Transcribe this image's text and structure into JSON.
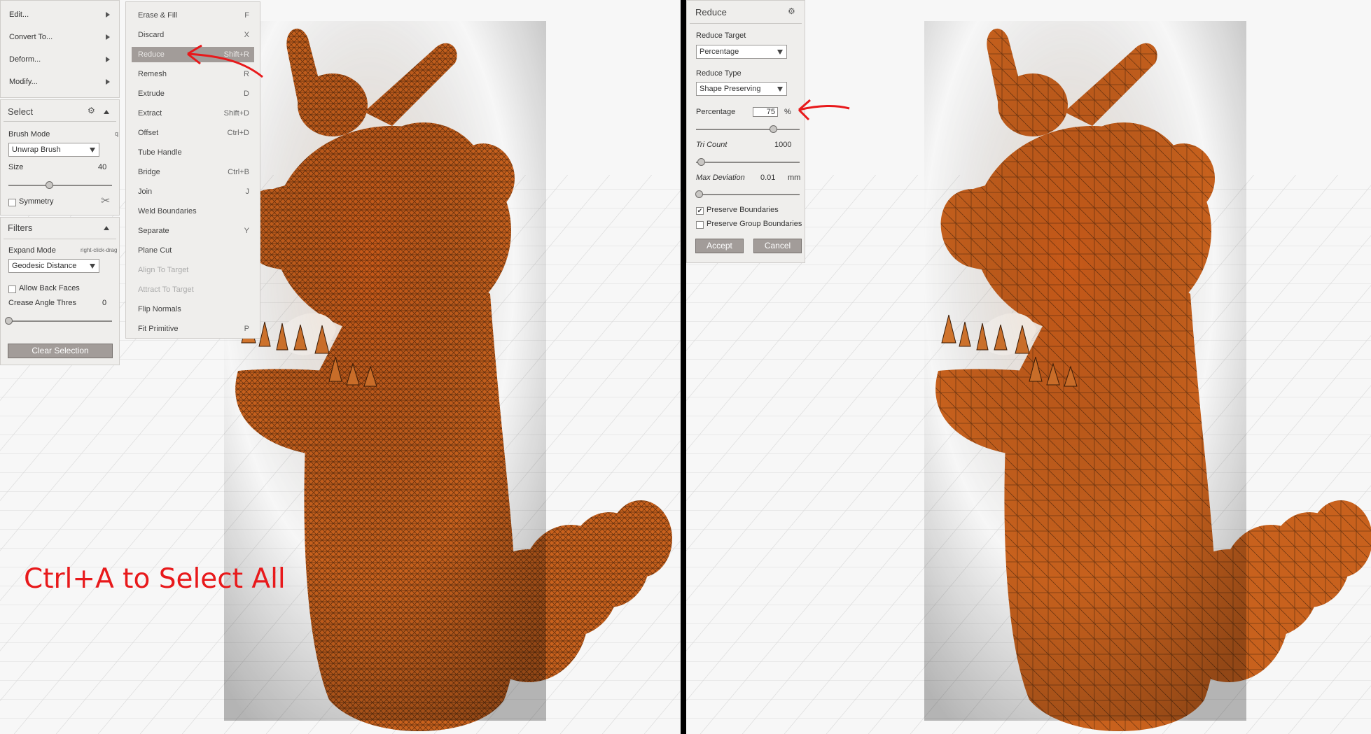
{
  "left": {
    "edit_menu": [
      {
        "label": "Edit..."
      },
      {
        "label": "Convert To..."
      },
      {
        "label": "Deform..."
      },
      {
        "label": "Modify..."
      }
    ],
    "select_panel": {
      "title": "Select",
      "brush_mode_label": "Brush Mode",
      "brush_mode_hotkey": "q",
      "brush_mode_value": "Unwrap Brush",
      "size_label": "Size",
      "size_value": "40",
      "size_fraction": 0.39,
      "symmetry_label": "Symmetry"
    },
    "filters_panel": {
      "title": "Filters",
      "expand_mode_label": "Expand Mode",
      "expand_mode_hint": "right-click-drag",
      "expand_mode_value": "Geodesic Distance",
      "allow_back_faces_label": "Allow Back Faces",
      "crease_label": "Crease Angle Thres",
      "crease_value": "0",
      "crease_fraction": 0.0,
      "clear_button": "Clear Selection"
    },
    "context_menu": [
      {
        "label": "Erase & Fill",
        "key": "F",
        "state": "normal"
      },
      {
        "label": "Discard",
        "key": "X",
        "state": "normal"
      },
      {
        "label": "Reduce",
        "key": "Shift+R",
        "state": "active"
      },
      {
        "label": "Remesh",
        "key": "R",
        "state": "normal"
      },
      {
        "label": "Extrude",
        "key": "D",
        "state": "normal"
      },
      {
        "label": "Extract",
        "key": "Shift+D",
        "state": "normal"
      },
      {
        "label": "Offset",
        "key": "Ctrl+D",
        "state": "normal"
      },
      {
        "label": "Tube Handle",
        "key": "",
        "state": "normal"
      },
      {
        "label": "Bridge",
        "key": "Ctrl+B",
        "state": "normal"
      },
      {
        "label": "Join",
        "key": "J",
        "state": "normal"
      },
      {
        "label": "Weld Boundaries",
        "key": "",
        "state": "normal"
      },
      {
        "label": "Separate",
        "key": "Y",
        "state": "normal"
      },
      {
        "label": "Plane Cut",
        "key": "",
        "state": "normal"
      },
      {
        "label": "Align To Target",
        "key": "",
        "state": "disabled"
      },
      {
        "label": "Attract To Target",
        "key": "",
        "state": "disabled"
      },
      {
        "label": "Flip Normals",
        "key": "",
        "state": "normal"
      },
      {
        "label": "Fit Primitive",
        "key": "P",
        "state": "normal"
      }
    ],
    "caption": "Ctrl+A to Select All"
  },
  "right": {
    "reduce_panel": {
      "title": "Reduce",
      "reduce_target_label": "Reduce Target",
      "reduce_target_value": "Percentage",
      "reduce_type_label": "Reduce Type",
      "reduce_type_value": "Shape Preserving",
      "percentage_label": "Percentage",
      "percentage_value": "75",
      "percentage_unit": "%",
      "percentage_fraction": 0.74,
      "tri_count_label": "Tri Count",
      "tri_count_value": "1000",
      "tri_count_fraction": 0.05,
      "max_deviation_label": "Max Deviation",
      "max_deviation_value": "0.01",
      "max_deviation_unit": "mm",
      "max_deviation_fraction": 0.03,
      "preserve_boundaries_label": "Preserve Boundaries",
      "preserve_boundaries_checked": true,
      "preserve_group_label": "Preserve Group Boundaries",
      "preserve_group_checked": false,
      "accept_button": "Accept",
      "cancel_button": "Cancel"
    }
  },
  "colors": {
    "mesh": "#c8611d",
    "mesh_dark": "#4a230a",
    "panel_bg": "#efeeec",
    "accent_red": "#e8191b"
  }
}
